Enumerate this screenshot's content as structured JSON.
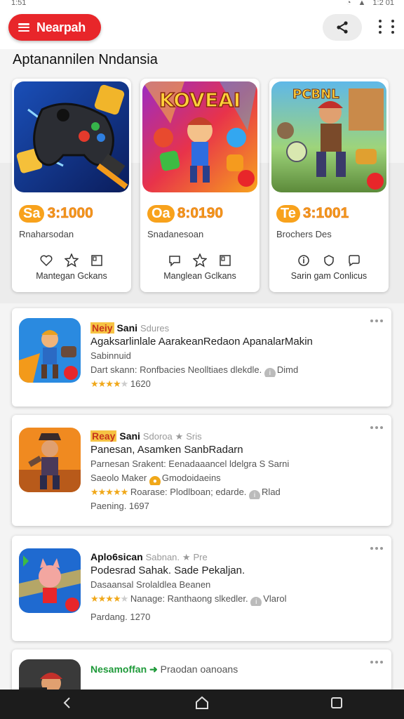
{
  "status": {
    "left": "1:51",
    "right": "1:2 01"
  },
  "header": {
    "menu_label": "Nearpah"
  },
  "section": {
    "title": "Aptanannilen Nndansia"
  },
  "colors": {
    "accent": "#e8262a",
    "price": "#f39a1a",
    "bg": "#f4f4f4"
  },
  "cards": [
    {
      "price_a": "Sa",
      "price_b": "3:1000",
      "subtitle": "Rnaharsodan",
      "footer": "Mantegan Gckans",
      "image": "game-controller-art"
    },
    {
      "price_a": "Oa",
      "price_b": "8:0190",
      "subtitle": "Snadanesoan",
      "footer": "Manglean Gclkans",
      "image": "koveai-characters-art",
      "image_text": "KOVEAI"
    },
    {
      "price_a": "Te",
      "price_b": "3:1001",
      "subtitle": "Brochers Des",
      "footer": "Sarin gam Conlicus",
      "image": "warrior-character-art",
      "image_text": "PCBNL"
    }
  ],
  "list": [
    {
      "hl": "Neiy",
      "brand": "Sani",
      "muted": "Sdures",
      "title": "Agaksarlinlale AarakeanRedaon ApanalarMakin",
      "lines": [
        "Sabinnuid",
        "Dart skann: Ronfbacies Neolltiaes dlekdle.",
        "Dimd"
      ],
      "rating": "4.0",
      "rating_text": "1620",
      "image": "runner-hero-art"
    },
    {
      "hl": "Reay",
      "brand": "Sani",
      "muted": "Sdoroa",
      "tag": "Sris",
      "title": "Panesan, Asamken SanbRadarn",
      "lines": [
        "Parnesan Srakent: Eenadaaancel ldelgra S Sarni",
        "Saeolo Maker",
        "Gmodoidaeins",
        "Roarase: Plodlboan; edarde.",
        "Rlad"
      ],
      "rating": "5.0",
      "footer": "Paening. 1697",
      "image": "pirate-character-art"
    },
    {
      "brand": "Aplo6sican",
      "muted": "Sabnan.",
      "tag": "Pre",
      "title": "Podesrad Sahak. Sade Pekaljan.",
      "lines": [
        "Dasaansal Srolaldlea Beanen",
        "Nanage: Ranthaong slkedler.",
        "Vlarol"
      ],
      "rating": "4.0",
      "footer": "Pardang. 1270",
      "image": "fox-character-art"
    },
    {
      "brand": "Nesamoffan",
      "text": "Praodan oanoans",
      "image": "gunner-character-art"
    }
  ]
}
